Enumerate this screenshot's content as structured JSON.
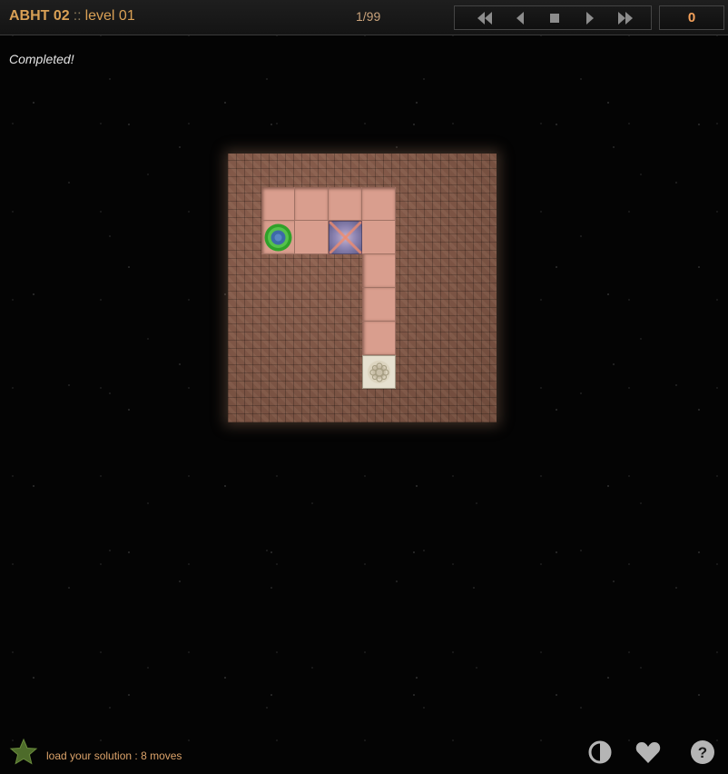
{
  "header": {
    "collection_name": "ABHT 02",
    "separator": "::",
    "level_name": "level 01",
    "level_counter": "1/99",
    "moves": "0"
  },
  "nav_controls": [
    "first-level-icon",
    "previous-level-icon",
    "stop-icon",
    "next-level-icon",
    "last-level-icon"
  ],
  "status": "Completed!",
  "board": {
    "grid_columns": 8,
    "grid_rows": 8,
    "floor_color": "#d99e8e",
    "wall_color": "#7a5342",
    "floor_cells": [
      [
        1,
        1
      ],
      [
        2,
        1
      ],
      [
        3,
        1
      ],
      [
        4,
        1
      ],
      [
        2,
        2
      ],
      [
        4,
        2
      ],
      [
        4,
        3
      ],
      [
        4,
        4
      ],
      [
        4,
        5
      ]
    ],
    "player_cell": [
      1,
      2
    ],
    "ice_cell": [
      3,
      2
    ],
    "goal_cell": [
      4,
      6
    ],
    "player_color": "#2fa12a"
  },
  "footer": {
    "load_solution": "load your solution : 8 moves",
    "star_color": "#4d6b2a",
    "icons": [
      "contrast-icon",
      "heart-icon",
      "help-icon"
    ]
  }
}
